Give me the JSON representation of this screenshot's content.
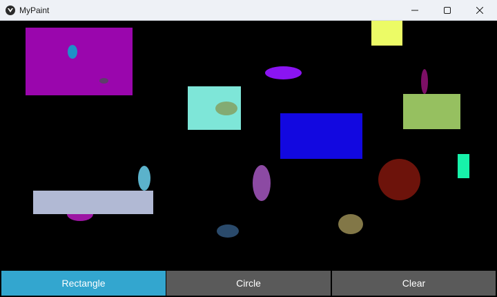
{
  "window": {
    "title": "MyPaint",
    "controls": [
      "minimize",
      "maximize",
      "close"
    ]
  },
  "canvas": {
    "background": "#000000",
    "shapes": [
      {
        "kind": "rectangle",
        "color": "#9a06ad"
      },
      {
        "kind": "ellipse",
        "color": "#1f90c8"
      },
      {
        "kind": "ellipse",
        "color": "#5d3d6b"
      },
      {
        "kind": "rectangle",
        "color": "#ecfb66"
      },
      {
        "kind": "ellipse",
        "color": "#8a14f2"
      },
      {
        "kind": "ellipse",
        "color": "#7d0f66"
      },
      {
        "kind": "rectangle",
        "color": "#7ee6d8"
      },
      {
        "kind": "ellipse",
        "color": "#83ab73"
      },
      {
        "kind": "rectangle",
        "color": "#96c060"
      },
      {
        "kind": "rectangle",
        "color": "#1208e0"
      },
      {
        "kind": "rectangle",
        "color": "#17f2aa"
      },
      {
        "kind": "ellipse",
        "color": "#5bb2cb"
      },
      {
        "kind": "ellipse",
        "color": "#9c16a3"
      },
      {
        "kind": "rectangle",
        "color": "#b1b9d4"
      },
      {
        "kind": "ellipse",
        "color": "#8c4aa3"
      },
      {
        "kind": "ellipse",
        "color": "#6d130b"
      },
      {
        "kind": "ellipse",
        "color": "#2a4a6b"
      },
      {
        "kind": "ellipse",
        "color": "#827747"
      }
    ]
  },
  "toolbar": {
    "rectangle_label": "Rectangle",
    "circle_label": "Circle",
    "clear_label": "Clear",
    "active_tool": "Rectangle",
    "active_color": "#33a6cf",
    "inactive_color": "#5a5a5a"
  }
}
